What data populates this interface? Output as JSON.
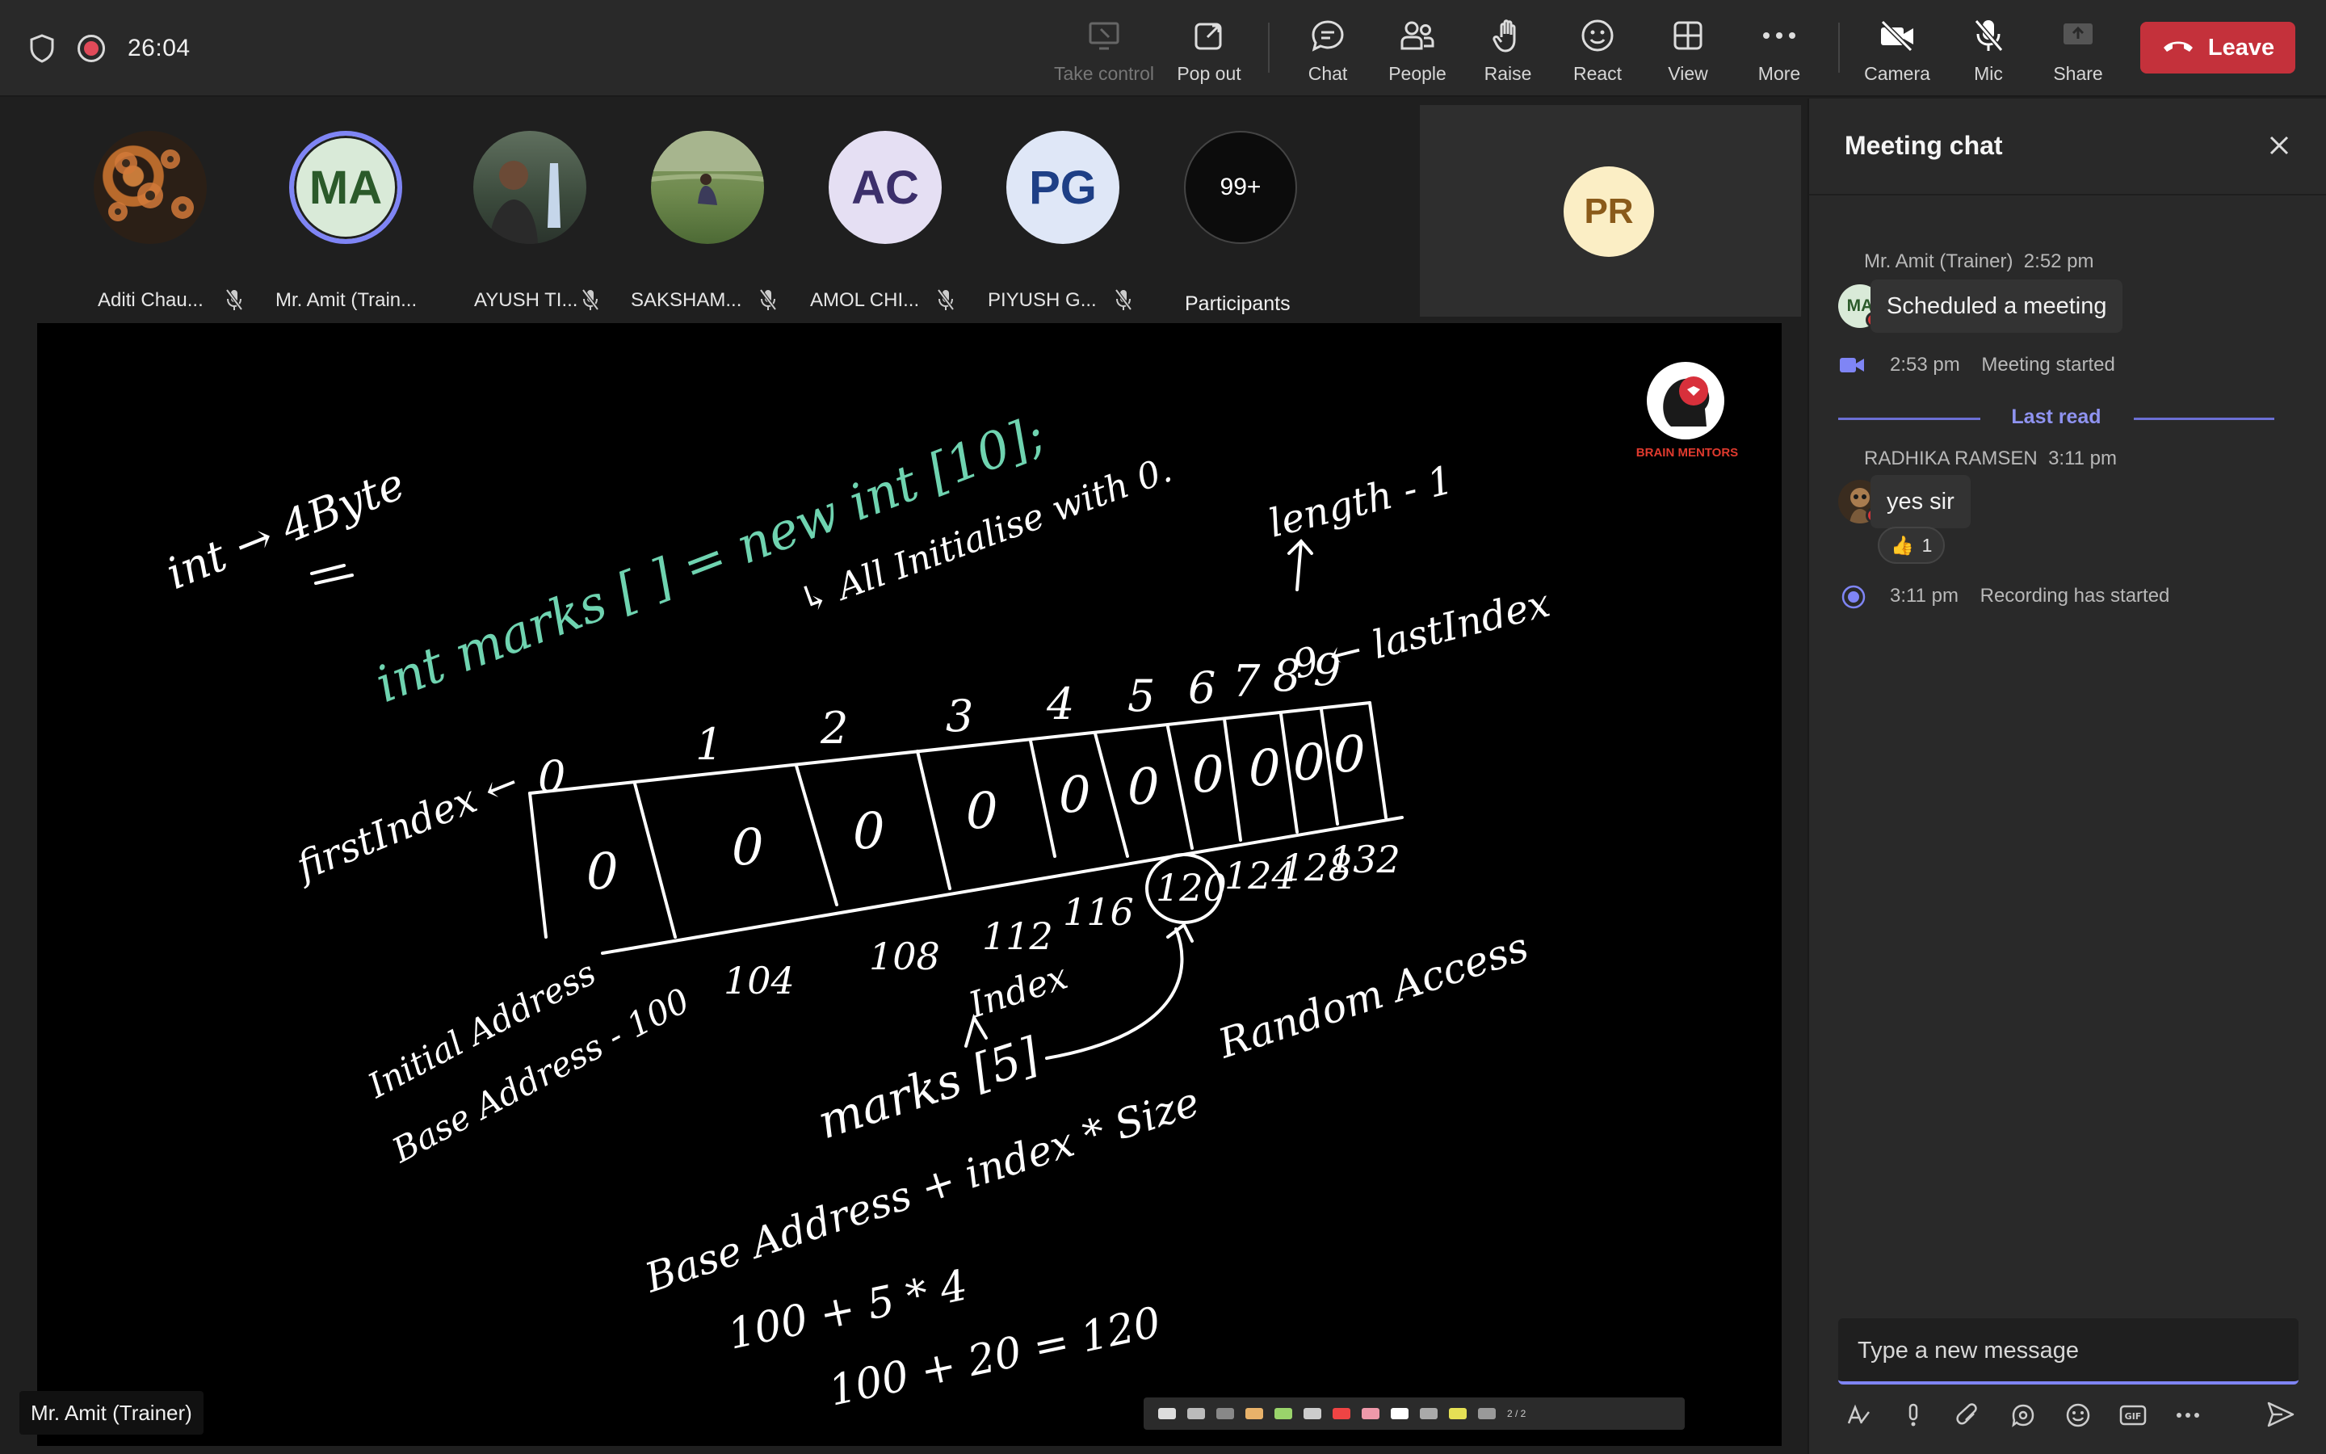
{
  "call": {
    "timer": "26:04"
  },
  "toolbar": {
    "take_control": "Take control",
    "pop_out": "Pop out",
    "chat": "Chat",
    "people": "People",
    "raise": "Raise",
    "react": "React",
    "view": "View",
    "more": "More",
    "camera": "Camera",
    "mic": "Mic",
    "share": "Share",
    "leave": "Leave"
  },
  "participants": [
    {
      "name": "Aditi Chau...",
      "initials": "",
      "muted": true
    },
    {
      "name": "Mr. Amit (Train...",
      "initials": "MA",
      "muted": false
    },
    {
      "name": "AYUSH TI...",
      "initials": "",
      "muted": true
    },
    {
      "name": "SAKSHAM...",
      "initials": "",
      "muted": true
    },
    {
      "name": "AMOL CHI...",
      "initials": "AC",
      "muted": true
    },
    {
      "name": "PIYUSH G...",
      "initials": "PG",
      "muted": true
    }
  ],
  "participants_overflow": {
    "count": "99+",
    "label": "Participants"
  },
  "pinned_tile": {
    "initials": "PR"
  },
  "shared_screen": {
    "presenter_label": "Mr. Amit (Trainer)",
    "logo_text": "BRAIN MENTORS",
    "page_indicator": "2 / 2",
    "whiteboard": {
      "line1": "int → 4Byte",
      "line2": "int marks [ ] = new int [10];",
      "line3": "↳ All Initialise with 0.",
      "length": "length - 1",
      "lastIndex": "9 ← lastIndex",
      "firstIndex": "firstIndex ←",
      "indices": [
        "0",
        "1",
        "2",
        "3",
        "4",
        "5",
        "6",
        "7",
        "8",
        "9"
      ],
      "cells": [
        "0",
        "0",
        "0",
        "0",
        "0",
        "0",
        "0",
        "0",
        "0",
        "0"
      ],
      "addresses": [
        "104",
        "108",
        "112",
        "116",
        "120",
        "124",
        "128",
        "132"
      ],
      "initial_address": "Initial Address",
      "base_address": "Base Address - 100",
      "index_label": "Index",
      "access": "marks [5]",
      "random": "Random Access",
      "formula": "Base Address + index * Size",
      "formula_vals": "100   +   5 * 4",
      "result": "100 + 20 = 120"
    }
  },
  "chat": {
    "title": "Meeting chat",
    "messages": [
      {
        "author": "Mr. Amit (Trainer)",
        "time": "2:52 pm",
        "text": "Scheduled a meeting",
        "initials": "MA"
      },
      {
        "author": "RADHIKA RAMSEN",
        "time": "3:11 pm",
        "text": "yes sir"
      }
    ],
    "event_meeting_started": {
      "time": "2:53 pm",
      "text": "Meeting started"
    },
    "last_read": "Last read",
    "reaction": {
      "emoji": "👍",
      "count": "1"
    },
    "event_recording": {
      "time": "3:11 pm",
      "text": "Recording has started"
    },
    "composer_placeholder": "Type a new message"
  },
  "colors": {
    "accent": "#7f85f5",
    "leave": "#c4313b",
    "board_chalk": "#ffffff",
    "board_code": "#6fd3b0"
  }
}
